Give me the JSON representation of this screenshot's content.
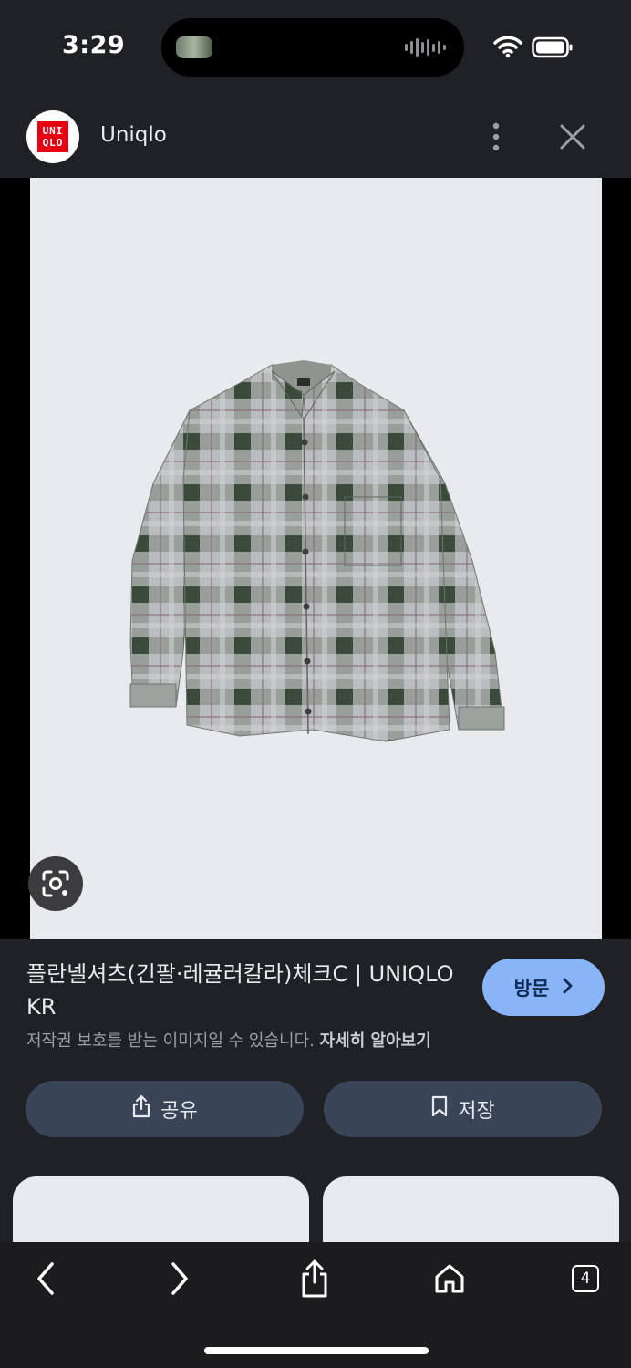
{
  "status_bar": {
    "time": "3:29"
  },
  "header": {
    "logo_text_top": "UNI",
    "logo_text_bottom": "QLO",
    "site_name": "Uniqlo"
  },
  "result": {
    "title": "플란넬셔츠(긴팔·레귤러칼라)체크C | UNIQLO KR",
    "copyright_notice": "저작권 보호를 받는 이미지일 수 있습니다.",
    "learn_more": "자세히 알아보기",
    "visit_label": "방문",
    "share_label": "공유",
    "save_label": "저장"
  },
  "browser_toolbar": {
    "tab_count": "4"
  },
  "colors": {
    "background": "#202124",
    "visit_button": "#8ab4f8",
    "action_pill": "#394457",
    "brand_red": "#e60012"
  },
  "icons": [
    "uniqlo-logo",
    "more-vert-icon",
    "close-icon",
    "google-lens-icon",
    "share-icon",
    "bookmark-icon",
    "chevron-right-icon",
    "back-icon",
    "forward-icon",
    "ios-share-icon",
    "home-icon",
    "tabs-icon"
  ]
}
